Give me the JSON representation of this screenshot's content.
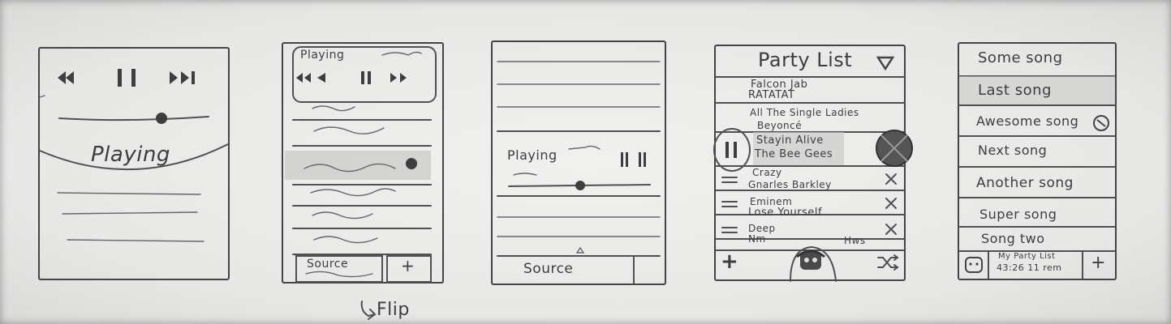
{
  "panel1": {
    "playing_label": "Playing"
  },
  "panel2": {
    "playing_label": "Playing",
    "source_label": "Source",
    "add_label": "+",
    "flip_label": "Flip"
  },
  "panel3": {
    "playing_label": "Playing",
    "source_label": "Source"
  },
  "panel4": {
    "title": "Party List",
    "dropdown_icon": "triangle-down",
    "songs": [
      {
        "artist": "Falcon Jab",
        "title": "RATATAT"
      },
      {
        "artist": "All The Single Ladies",
        "title": "Beyoncé"
      },
      {
        "artist": "Stayin Alive",
        "title": "The Bee Gees"
      },
      {
        "artist": "Crazy",
        "title": "Gnarles Barkley"
      },
      {
        "artist": "Eminem",
        "title": "Lose Yourself"
      },
      {
        "artist": "Deep",
        "title": "Nm"
      }
    ],
    "now_playing_extra": "Hws",
    "add_label": "+",
    "shuffle_icon": "shuffle"
  },
  "panel5": {
    "songs": [
      "Some song",
      "Last song",
      "Awesome song",
      "Next song",
      "Another song",
      "Super song",
      "Song two"
    ],
    "list_name": "My Party List",
    "list_duration": "43:26 11 rem",
    "add_label": "+"
  }
}
